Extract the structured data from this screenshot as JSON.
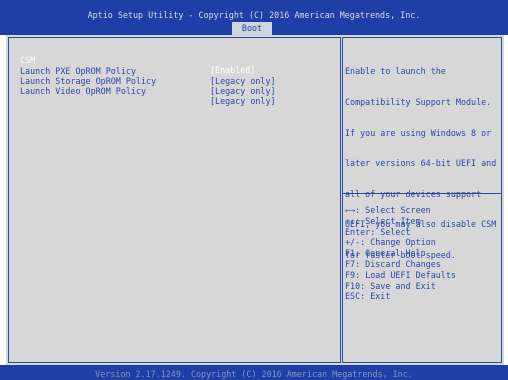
{
  "header": {
    "title": "Aptio Setup Utility - Copyright (C) 2016 American Megatrends, Inc.",
    "active_tab": "Boot"
  },
  "settings": [
    {
      "label": "CSM",
      "value": "[Enabled]"
    },
    {
      "label": "Launch PXE OpROM Policy",
      "value": "[Legacy only]"
    },
    {
      "label": "Launch Storage OpROM Policy",
      "value": "[Legacy only]"
    },
    {
      "label": "Launch Video OpROM Policy",
      "value": "[Legacy only]"
    }
  ],
  "help": {
    "lines": [
      "Enable to launch the",
      "Compatibility Support Module.",
      "If you are using Windows 8 or",
      "later versions 64-bit UEFI and",
      "all of your devices support",
      "UEFI, you may also disable CSM",
      "for faster boot speed."
    ]
  },
  "keys": [
    "←→: Select Screen",
    "↑↓: Select Item",
    "Enter: Select",
    "+/-: Change Option",
    "F1: General Help",
    "F7: Discard Changes",
    "F9: Load UEFI Defaults",
    "F10: Save and Exit",
    "ESC: Exit"
  ],
  "footer": {
    "text": "Version 2.17.1249. Copyright (C) 2016 American Megatrends, Inc."
  }
}
